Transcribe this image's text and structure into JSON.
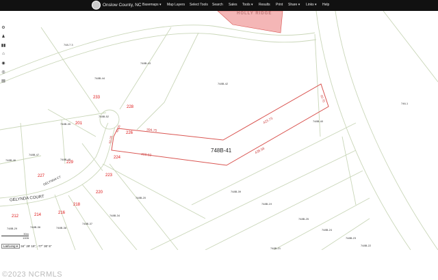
{
  "app": {
    "title": "Onslow County, NC",
    "nav": [
      "Basemaps ▾",
      "Map Layers",
      "Select Tools",
      "Search",
      "Sales",
      "Tools ▾",
      "Results",
      "Print",
      "Share ▾",
      "Links ▾",
      "Help"
    ]
  },
  "toolbar": {
    "icons": [
      "gear-icon",
      "person-icon",
      "binoculars-icon",
      "home-icon",
      "pin-icon",
      "eye-icon",
      "trash-icon"
    ],
    "glyphs": [
      "⚙",
      "♟",
      "▮▮",
      "⌂",
      "◉",
      "◎",
      "▤"
    ]
  },
  "map": {
    "town_label": "HOLLY RIDGE",
    "street_label": "GELYNDA COURT",
    "street_label_2": "GELYNDA CT",
    "selected_parcel": {
      "id": "748B-41",
      "dims": {
        "d1": "423.73",
        "d2": "394.75",
        "d3": "438.58",
        "d4": "460.92",
        "d5": "60.75",
        "d6": "40.00",
        "d7": "50.00"
      }
    },
    "address_pins": [
      "233",
      "228",
      "201",
      "226",
      "224",
      "229",
      "223",
      "227",
      "220",
      "218",
      "216",
      "214",
      "212"
    ],
    "parcel_labels": [
      "748-7.3",
      "748B-43",
      "748B-44",
      "748B-42",
      "748B-52",
      "748B-35",
      "748B-46",
      "748B-47",
      "748B-45",
      "748B-40",
      "748B-39",
      "748B-20",
      "748B-19",
      "748B-34",
      "748B-37",
      "748B-38",
      "748B-36",
      "748B-29",
      "748B-25",
      "748B-24",
      "748B-23",
      "748B-22",
      "748B-21",
      "746-1"
    ],
    "scale": {
      "top": "30m",
      "bottom": "100ft"
    },
    "coordinate": {
      "mode": "Lat/Long ▾",
      "value": "34° 29' 15\", -77° 30' 5\""
    }
  },
  "footer": "©2023 NCRMLS",
  "colors": {
    "navbar": "#111111",
    "parcel_line": "#c9d6b8",
    "selected_parcel": "#d9534f",
    "town_fill": "#f4b6b6"
  }
}
